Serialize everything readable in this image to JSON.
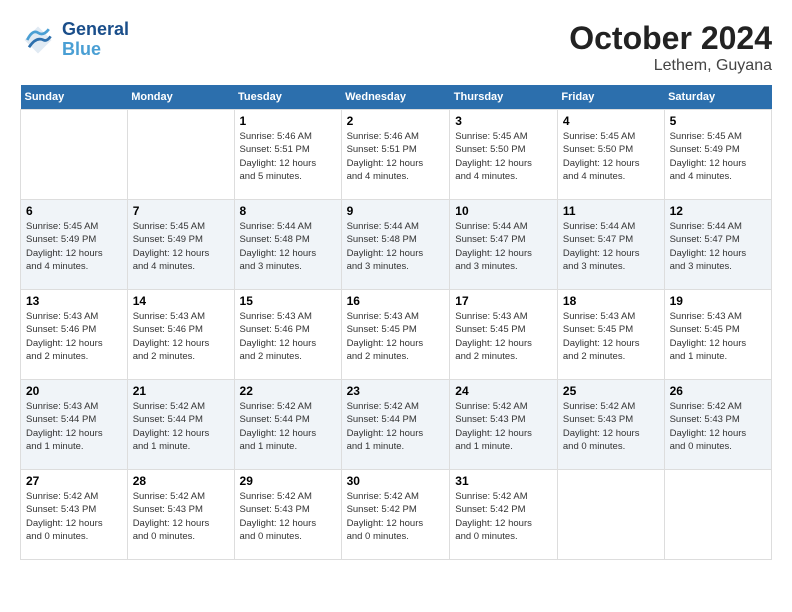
{
  "header": {
    "logo_general": "General",
    "logo_blue": "Blue",
    "month_title": "October 2024",
    "subtitle": "Lethem, Guyana"
  },
  "days_of_week": [
    "Sunday",
    "Monday",
    "Tuesday",
    "Wednesday",
    "Thursday",
    "Friday",
    "Saturday"
  ],
  "weeks": [
    [
      {
        "day": "",
        "info": ""
      },
      {
        "day": "",
        "info": ""
      },
      {
        "day": "1",
        "info": "Sunrise: 5:46 AM\nSunset: 5:51 PM\nDaylight: 12 hours\nand 5 minutes."
      },
      {
        "day": "2",
        "info": "Sunrise: 5:46 AM\nSunset: 5:51 PM\nDaylight: 12 hours\nand 4 minutes."
      },
      {
        "day": "3",
        "info": "Sunrise: 5:45 AM\nSunset: 5:50 PM\nDaylight: 12 hours\nand 4 minutes."
      },
      {
        "day": "4",
        "info": "Sunrise: 5:45 AM\nSunset: 5:50 PM\nDaylight: 12 hours\nand 4 minutes."
      },
      {
        "day": "5",
        "info": "Sunrise: 5:45 AM\nSunset: 5:49 PM\nDaylight: 12 hours\nand 4 minutes."
      }
    ],
    [
      {
        "day": "6",
        "info": "Sunrise: 5:45 AM\nSunset: 5:49 PM\nDaylight: 12 hours\nand 4 minutes."
      },
      {
        "day": "7",
        "info": "Sunrise: 5:45 AM\nSunset: 5:49 PM\nDaylight: 12 hours\nand 4 minutes."
      },
      {
        "day": "8",
        "info": "Sunrise: 5:44 AM\nSunset: 5:48 PM\nDaylight: 12 hours\nand 3 minutes."
      },
      {
        "day": "9",
        "info": "Sunrise: 5:44 AM\nSunset: 5:48 PM\nDaylight: 12 hours\nand 3 minutes."
      },
      {
        "day": "10",
        "info": "Sunrise: 5:44 AM\nSunset: 5:47 PM\nDaylight: 12 hours\nand 3 minutes."
      },
      {
        "day": "11",
        "info": "Sunrise: 5:44 AM\nSunset: 5:47 PM\nDaylight: 12 hours\nand 3 minutes."
      },
      {
        "day": "12",
        "info": "Sunrise: 5:44 AM\nSunset: 5:47 PM\nDaylight: 12 hours\nand 3 minutes."
      }
    ],
    [
      {
        "day": "13",
        "info": "Sunrise: 5:43 AM\nSunset: 5:46 PM\nDaylight: 12 hours\nand 2 minutes."
      },
      {
        "day": "14",
        "info": "Sunrise: 5:43 AM\nSunset: 5:46 PM\nDaylight: 12 hours\nand 2 minutes."
      },
      {
        "day": "15",
        "info": "Sunrise: 5:43 AM\nSunset: 5:46 PM\nDaylight: 12 hours\nand 2 minutes."
      },
      {
        "day": "16",
        "info": "Sunrise: 5:43 AM\nSunset: 5:45 PM\nDaylight: 12 hours\nand 2 minutes."
      },
      {
        "day": "17",
        "info": "Sunrise: 5:43 AM\nSunset: 5:45 PM\nDaylight: 12 hours\nand 2 minutes."
      },
      {
        "day": "18",
        "info": "Sunrise: 5:43 AM\nSunset: 5:45 PM\nDaylight: 12 hours\nand 2 minutes."
      },
      {
        "day": "19",
        "info": "Sunrise: 5:43 AM\nSunset: 5:45 PM\nDaylight: 12 hours\nand 1 minute."
      }
    ],
    [
      {
        "day": "20",
        "info": "Sunrise: 5:43 AM\nSunset: 5:44 PM\nDaylight: 12 hours\nand 1 minute."
      },
      {
        "day": "21",
        "info": "Sunrise: 5:42 AM\nSunset: 5:44 PM\nDaylight: 12 hours\nand 1 minute."
      },
      {
        "day": "22",
        "info": "Sunrise: 5:42 AM\nSunset: 5:44 PM\nDaylight: 12 hours\nand 1 minute."
      },
      {
        "day": "23",
        "info": "Sunrise: 5:42 AM\nSunset: 5:44 PM\nDaylight: 12 hours\nand 1 minute."
      },
      {
        "day": "24",
        "info": "Sunrise: 5:42 AM\nSunset: 5:43 PM\nDaylight: 12 hours\nand 1 minute."
      },
      {
        "day": "25",
        "info": "Sunrise: 5:42 AM\nSunset: 5:43 PM\nDaylight: 12 hours\nand 0 minutes."
      },
      {
        "day": "26",
        "info": "Sunrise: 5:42 AM\nSunset: 5:43 PM\nDaylight: 12 hours\nand 0 minutes."
      }
    ],
    [
      {
        "day": "27",
        "info": "Sunrise: 5:42 AM\nSunset: 5:43 PM\nDaylight: 12 hours\nand 0 minutes."
      },
      {
        "day": "28",
        "info": "Sunrise: 5:42 AM\nSunset: 5:43 PM\nDaylight: 12 hours\nand 0 minutes."
      },
      {
        "day": "29",
        "info": "Sunrise: 5:42 AM\nSunset: 5:43 PM\nDaylight: 12 hours\nand 0 minutes."
      },
      {
        "day": "30",
        "info": "Sunrise: 5:42 AM\nSunset: 5:42 PM\nDaylight: 12 hours\nand 0 minutes."
      },
      {
        "day": "31",
        "info": "Sunrise: 5:42 AM\nSunset: 5:42 PM\nDaylight: 12 hours\nand 0 minutes."
      },
      {
        "day": "",
        "info": ""
      },
      {
        "day": "",
        "info": ""
      }
    ]
  ]
}
